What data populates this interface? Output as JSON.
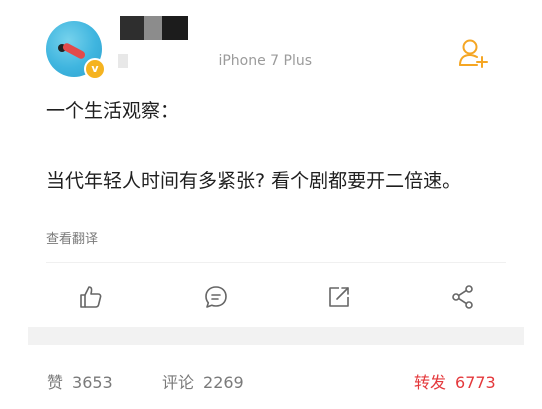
{
  "post": {
    "device_source": "iPhone 7 Plus",
    "badge_symbol": "v",
    "line1": "一个生活观察：",
    "line2": "当代年轻人时间有多紧张? 看个剧都要开二倍速。",
    "translate_label": "查看翻译"
  },
  "actions": {
    "like_icon": "thumbs-up-icon",
    "comment_icon": "comment-icon",
    "repost_icon": "repost-icon",
    "share_icon": "share-icon",
    "follow_icon": "add-friend-icon"
  },
  "stats": {
    "like_label": "赞",
    "like_count": "3653",
    "comment_label": "评论",
    "comment_count": "2269",
    "repost_label": "转发",
    "repost_count": "6773"
  },
  "colors": {
    "accent_orange": "#f5b320",
    "repost_red": "#e4393c",
    "text_dark": "#1f1f1f",
    "text_gray": "#7a7a7a"
  }
}
